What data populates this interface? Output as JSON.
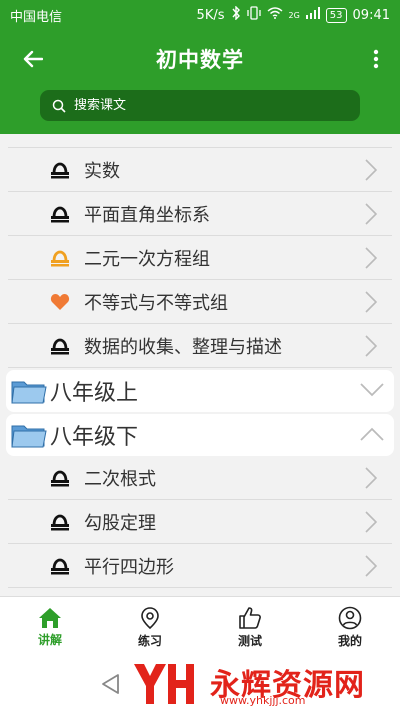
{
  "status_bar": {
    "carrier": "中国电信",
    "speed": "5K/s",
    "network": "2G",
    "battery": "53",
    "time": "09:41"
  },
  "header": {
    "title": "初中数学",
    "search_placeholder": "搜索课文"
  },
  "chapters_top": [
    {
      "label": "实数",
      "icon": "scale-icon"
    },
    {
      "label": "平面直角坐标系",
      "icon": "scale-icon"
    },
    {
      "label": "二元一次方程组",
      "icon": "scale-icon-orange"
    },
    {
      "label": "不等式与不等式组",
      "icon": "heart-icon"
    },
    {
      "label": "数据的收集、整理与描述",
      "icon": "scale-icon"
    }
  ],
  "groups": [
    {
      "label": "八年级上",
      "expanded": false
    },
    {
      "label": "八年级下",
      "expanded": true
    }
  ],
  "chapters_bottom": [
    {
      "label": "二次根式",
      "icon": "scale-icon"
    },
    {
      "label": "勾股定理",
      "icon": "scale-icon"
    },
    {
      "label": "平行四边形",
      "icon": "scale-icon"
    }
  ],
  "bottom_nav": [
    {
      "label": "讲解",
      "icon": "home-icon",
      "active": true
    },
    {
      "label": "练习",
      "icon": "location-icon",
      "active": false
    },
    {
      "label": "测试",
      "icon": "thumbs-up-icon",
      "active": false
    },
    {
      "label": "我的",
      "icon": "user-icon",
      "active": false
    }
  ],
  "watermark": {
    "text": "永辉资源网",
    "url": "www.yhkjjj.com"
  },
  "colors": {
    "primary": "#2e9e2a",
    "search_bg": "#1c6d1a",
    "orange": "#f0a020",
    "heart": "#f07a35"
  }
}
